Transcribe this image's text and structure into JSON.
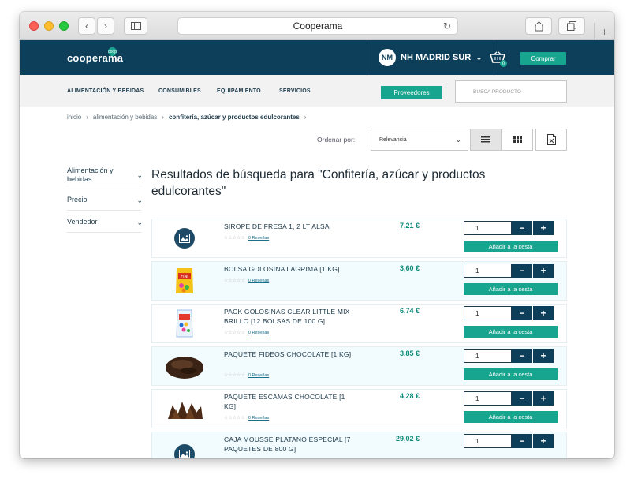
{
  "browser": {
    "url_title": "Cooperama"
  },
  "header": {
    "logo": "cooperama",
    "logo_badge": "coop",
    "user_initials": "NM",
    "user_name": "NH MADRID SUR",
    "cart_count": "0",
    "buy_label": "Comprar"
  },
  "nav": {
    "items": [
      "ALIMENTACIÓN Y BEBIDAS",
      "CONSUMIBLES",
      "EQUIPAMIENTO",
      "SERVICIOS"
    ],
    "suppliers_label": "Proveedores",
    "search_placeholder": "BUSCA PRODUCTO"
  },
  "breadcrumb": [
    "inicio",
    "alimentación y bebidas",
    "confitería, azúcar y productos edulcorantes"
  ],
  "sort": {
    "label": "Ordenar por:",
    "selected": "Relevancia"
  },
  "filters": [
    {
      "label": "Alimentación y bebidas"
    },
    {
      "label": "Precio"
    },
    {
      "label": "Vendedor"
    }
  ],
  "results_heading": "Resultados de búsqueda para \"Confitería, azúcar y productos edulcorantes\"",
  "cart_button_label": "Añadir a la cesta",
  "reviews_label": "0 Reseñas",
  "products": [
    {
      "name": "SIROPE DE FRESA 1, 2 LT ALSA",
      "price": "7,21 €",
      "qty": "1",
      "image": "placeholder"
    },
    {
      "name": "BOLSA GOLOSINA LAGRIMA [1 KG]",
      "price": "3,60 €",
      "qty": "1",
      "image": "candy-bag"
    },
    {
      "name": "PACK GOLOSINAS CLEAR LITTLE MIX BRILLO [12 BOLSAS DE 100 G]",
      "price": "6,74 €",
      "qty": "1",
      "image": "candy-pack"
    },
    {
      "name": "PAQUETE FIDEOS CHOCOLATE [1 KG]",
      "price": "3,85 €",
      "qty": "1",
      "image": "chocolate-sprinkles"
    },
    {
      "name": "PAQUETE ESCAMAS CHOCOLATE [1 KG]",
      "price": "4,28 €",
      "qty": "1",
      "image": "chocolate-flakes"
    },
    {
      "name": "CAJA MOUSSE PLATANO ESPECIAL [7 PAQUETES DE 800 G]",
      "price": "29,02 €",
      "qty": "1",
      "image": "placeholder"
    }
  ],
  "colors": {
    "header_bg": "#0e3f5a",
    "accent": "#17a58f",
    "price": "#0e8a78"
  }
}
